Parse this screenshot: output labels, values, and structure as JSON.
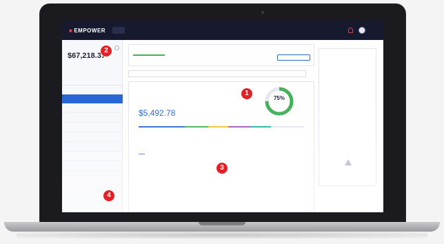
{
  "app": {
    "logo_text": "EMPOWER"
  },
  "sidebar": {
    "net_worth_value": "$67,218.37"
  },
  "main": {
    "plan_value": "$5,492.78",
    "progress_percent": "75%"
  },
  "callouts": [
    "1",
    "2",
    "3",
    "4"
  ],
  "colors": {
    "nav_bg": "#17192e",
    "accent_blue": "#2b66d6",
    "ring_green": "#45b05a",
    "marker_red": "#e41f26"
  }
}
